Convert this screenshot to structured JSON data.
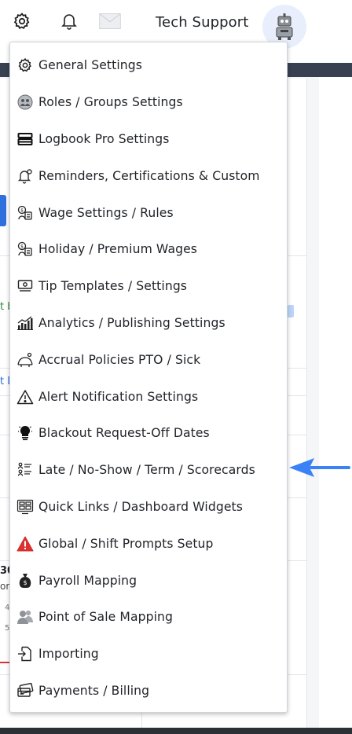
{
  "header": {
    "title": "Tech Support",
    "icons": [
      "gear-icon",
      "bell-icon",
      "mail-icon",
      "robot-avatar-icon"
    ]
  },
  "menu": {
    "items": [
      {
        "label": "General Settings",
        "icon": "gear-icon"
      },
      {
        "label": "Roles / Groups Settings",
        "icon": "roles-icon"
      },
      {
        "label": "Logbook Pro Settings",
        "icon": "logbook-icon"
      },
      {
        "label": "Reminders, Certifications & Custom",
        "icon": "reminder-icon"
      },
      {
        "label": "Wage Settings / Rules",
        "icon": "wage-icon"
      },
      {
        "label": "Holiday / Premium Wages",
        "icon": "holiday-wage-icon"
      },
      {
        "label": "Tip Templates / Settings",
        "icon": "tip-icon"
      },
      {
        "label": "Analytics / Publishing Settings",
        "icon": "analytics-icon"
      },
      {
        "label": "Accrual Policies PTO / Sick",
        "icon": "accrual-icon"
      },
      {
        "label": "Alert Notification Settings",
        "icon": "alert-icon"
      },
      {
        "label": "Blackout Request-Off Dates",
        "icon": "blackout-icon"
      },
      {
        "label": "Late / No-Show / Term / Scorecards",
        "icon": "scorecard-icon"
      },
      {
        "label": "Quick Links / Dashboard Widgets",
        "icon": "quicklinks-icon"
      },
      {
        "label": "Global / Shift Prompts Setup",
        "icon": "warning-icon"
      },
      {
        "label": "Payroll Mapping",
        "icon": "payroll-icon"
      },
      {
        "label": "Point of Sale Mapping",
        "icon": "pos-icon"
      },
      {
        "label": "Importing",
        "icon": "import-icon"
      },
      {
        "label": "Payments / Billing",
        "icon": "billing-icon"
      }
    ]
  },
  "background": {
    "green_snippet": "t b",
    "blue_snippet": "t D",
    "number_snippet": "30",
    "sub_snippet": "on",
    "mini_1": "4",
    "mini_2": "5"
  },
  "colors": {
    "accent_blue": "#2f6fde",
    "arrow_blue": "#3b82f6",
    "alert_red": "#e03131",
    "dark_band": "#374151"
  }
}
